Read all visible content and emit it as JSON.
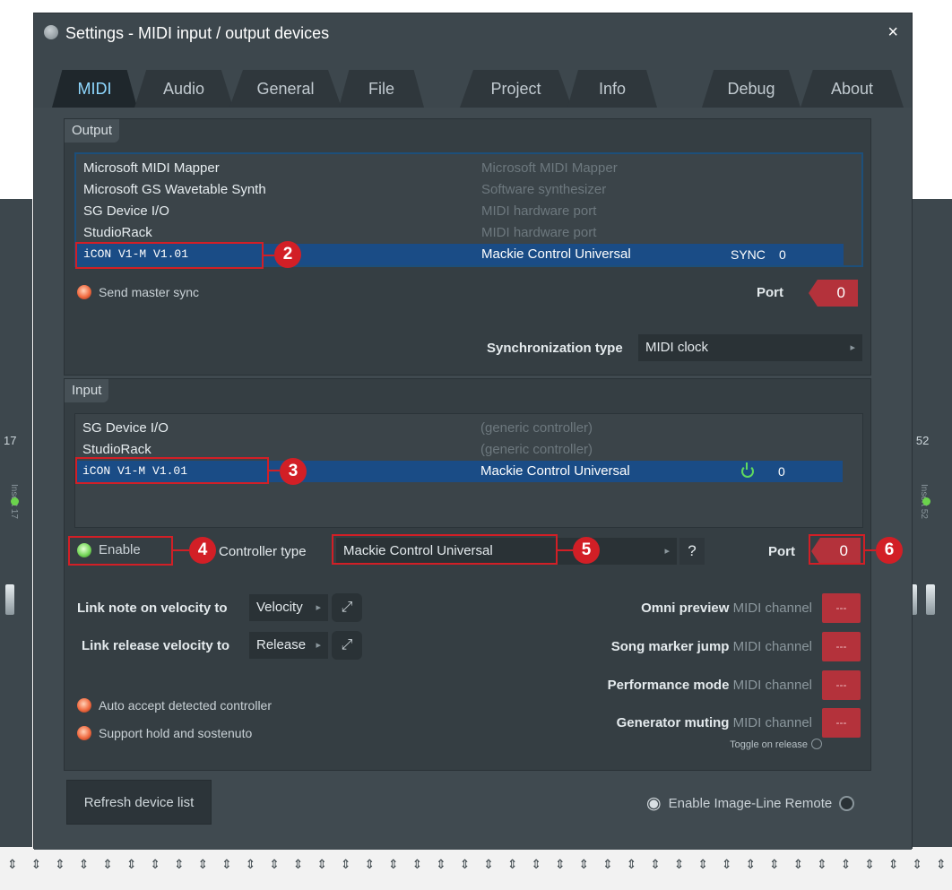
{
  "window": {
    "title": "Settings - MIDI input / output devices",
    "close_glyph": "×",
    "icon": "app-icon"
  },
  "tabs": [
    {
      "label": "MIDI",
      "active": true
    },
    {
      "label": "Audio"
    },
    {
      "label": "General"
    },
    {
      "label": "File"
    },
    {
      "label": "Project"
    },
    {
      "label": "Info"
    },
    {
      "label": "Debug"
    },
    {
      "label": "About"
    }
  ],
  "output": {
    "title": "Output",
    "devices": [
      {
        "name": "Microsoft MIDI Mapper",
        "type": "Microsoft MIDI Mapper"
      },
      {
        "name": "Microsoft GS Wavetable Synth",
        "type": "Software synthesizer"
      },
      {
        "name": "SG Device I/O",
        "type": "MIDI hardware port"
      },
      {
        "name": "StudioRack",
        "type": "MIDI hardware port"
      },
      {
        "name": "iCON V1-M V1.01",
        "type": "Mackie Control Universal",
        "sync": "SYNC",
        "port": "0"
      }
    ],
    "send_master_sync": "Send master sync",
    "port_label": "Port",
    "port_value": "0",
    "sync_type_label": "Synchronization type",
    "sync_type_value": "MIDI clock"
  },
  "input": {
    "title": "Input",
    "devices": [
      {
        "name": "SG Device I/O",
        "type": "(generic controller)"
      },
      {
        "name": "StudioRack",
        "type": "(generic controller)"
      },
      {
        "name": "iCON V1-M V1.01",
        "type": "Mackie Control Universal",
        "port": "0"
      }
    ],
    "enable_label": "Enable",
    "controller_type_label": "Controller type",
    "controller_type_value": "Mackie Control Universal",
    "help_glyph": "?",
    "port_label": "Port",
    "port_value": "0",
    "link_note_label": "Link note on velocity to",
    "link_note_value": "Velocity",
    "link_release_label": "Link release velocity to",
    "link_release_value": "Release",
    "auto_accept": "Auto accept detected controller",
    "support_hold": "Support hold and sostenuto",
    "midi_channel_suffix": "MIDI channel",
    "channels": [
      {
        "label": "Omni preview",
        "value": "---"
      },
      {
        "label": "Song marker jump",
        "value": "---"
      },
      {
        "label": "Performance mode",
        "value": "---"
      },
      {
        "label": "Generator muting",
        "value": "---"
      }
    ],
    "toggle_on_release": "Toggle on release"
  },
  "footer": {
    "refresh_button": "Refresh device list",
    "enable_remote": "Enable Image-Line Remote"
  },
  "background": {
    "left_strip_number": "17",
    "left_strip_label": "Insert 17",
    "right_strip_numbers": "1   52",
    "right_strip_label": "Insert 52"
  },
  "callouts": [
    "2",
    "3",
    "4",
    "5",
    "6"
  ],
  "colors": {
    "accent_tab": "#8fd8ff",
    "selection": "#1a4c86",
    "port_red": "#b4323b",
    "callout_red": "#d21f26"
  }
}
